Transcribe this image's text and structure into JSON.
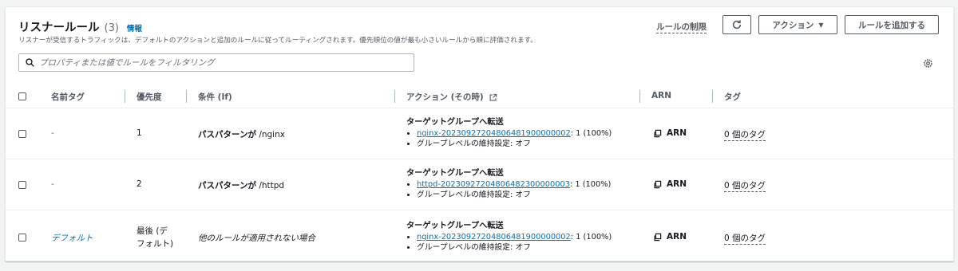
{
  "header": {
    "title": "リスナールール",
    "count": "(3)",
    "info": "情報",
    "description": "リスナーが受信するトラフィックは、デフォルトのアクションと追加のルールに従ってルーティングされます。優先順位の値が最も小さいルールから順に評価されます。",
    "limits_link": "ルールの制限",
    "action_button": "アクション",
    "add_rule_button": "ルールを追加する"
  },
  "search": {
    "placeholder": "プロパティまたは値でルールをフィルタリング"
  },
  "columns": {
    "name_tag": "名前タグ",
    "priority": "優先度",
    "condition": "条件 (If)",
    "action": "アクション (その時)",
    "arn": "ARN",
    "tags": "タグ"
  },
  "rows": [
    {
      "name": "-",
      "priority": "1",
      "condition_bold": "パスパターンが",
      "condition_value": " /nginx",
      "action_title": "ターゲットグループへ転送",
      "target_group": "nginx-20230927204806481900000002",
      "weight": ": 1 (100%)",
      "stickiness": "グループレベルの維持設定: オフ",
      "arn": "ARN",
      "tags": "0 個のタグ"
    },
    {
      "name": "-",
      "priority": "2",
      "condition_bold": "パスパターンが",
      "condition_value": " /httpd",
      "action_title": "ターゲットグループへ転送",
      "target_group": "httpd-20230927204806482300000003",
      "weight": ": 1 (100%)",
      "stickiness": "グループレベルの維持設定: オフ",
      "arn": "ARN",
      "tags": "0 個のタグ"
    },
    {
      "name": "デフォルト",
      "priority_line1": "最後 (デ",
      "priority_line2": "フォルト)",
      "condition_italic": "他のルールが適用されない場合",
      "action_title": "ターゲットグループへ転送",
      "target_group": "nginx-20230927204806481900000002",
      "weight": ": 1 (100%)",
      "stickiness": "グループレベルの維持設定: オフ",
      "arn": "ARN",
      "tags": "0 個のタグ"
    }
  ],
  "colors": {
    "link": "#0073bb",
    "text": "#16191f",
    "muted": "#545b64",
    "background": "#f2f3f3"
  },
  "icons": [
    "refresh-icon",
    "caret-down-icon",
    "search-icon",
    "gear-icon",
    "external-link-icon",
    "copy-icon"
  ]
}
